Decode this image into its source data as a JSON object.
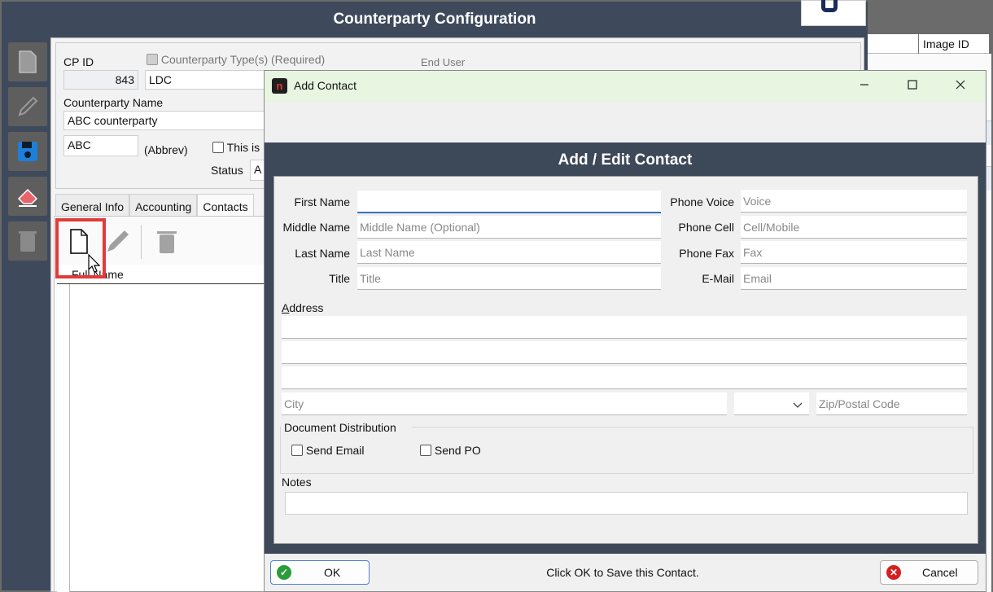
{
  "window": {
    "title": "Counterparty Configuration",
    "right_column_header": "Image ID"
  },
  "counterparty": {
    "cp_id_label": "CP ID",
    "cp_id_value": "843",
    "type_label": "Counterparty Type(s) (Required)",
    "type_value": "LDC",
    "end_user_label": "End User",
    "name_label": "Counterparty Name",
    "name_value": "ABC counterparty",
    "abbrev_value": "ABC",
    "abbrev_label": "(Abbrev)",
    "this_is_label": "This is",
    "status_label": "Status",
    "status_value": "A"
  },
  "tabs": [
    "General Info",
    "Accounting",
    "Contacts"
  ],
  "contacts_grid": {
    "column_full_name": "Full Name"
  },
  "dialog": {
    "title": "Add Contact",
    "app_icon_glyph": "n",
    "header": "Add / Edit Contact",
    "fields": {
      "first_name": {
        "label": "First Name",
        "value": "",
        "placeholder": ""
      },
      "middle_name": {
        "label": "Middle Name",
        "placeholder": "Middle Name (Optional)"
      },
      "last_name": {
        "label": "Last Name",
        "placeholder": "Last Name"
      },
      "title": {
        "label": "Title",
        "placeholder": "Title"
      },
      "phone_voice": {
        "label": "Phone Voice",
        "placeholder": "Voice"
      },
      "phone_cell": {
        "label": "Phone Cell",
        "placeholder": "Cell/Mobile"
      },
      "phone_fax": {
        "label": "Phone Fax",
        "placeholder": "Fax"
      },
      "email": {
        "label": "E-Mail",
        "placeholder": "Email"
      }
    },
    "address_label_first": "A",
    "address_label_rest": "ddress",
    "city_placeholder": "City",
    "zip_placeholder": "Zip/Postal Code",
    "state_value": "",
    "doc_dist_label": "Document Distribution",
    "send_email_label": "Send Email",
    "send_po_label": "Send PO",
    "notes_label": "Notes",
    "ok_label": "OK",
    "cancel_label": "Cancel",
    "status_message": "Click OK to Save this Contact."
  },
  "colors": {
    "window_bg": "#3e4a5c",
    "dialog_title_bg": "#e7f5e1",
    "highlight": "#e23a3a",
    "focus": "#3a6fc2",
    "ok_icon": "#2a9d3a",
    "cancel_icon": "#d42020"
  },
  "icons": {
    "toolbar": [
      "new-document-icon",
      "edit-pencil-icon",
      "save-disk-icon",
      "eraser-icon",
      "trash-icon"
    ],
    "grid_toolbar": [
      "new-document-icon",
      "edit-pencil-icon",
      "trash-icon"
    ]
  }
}
